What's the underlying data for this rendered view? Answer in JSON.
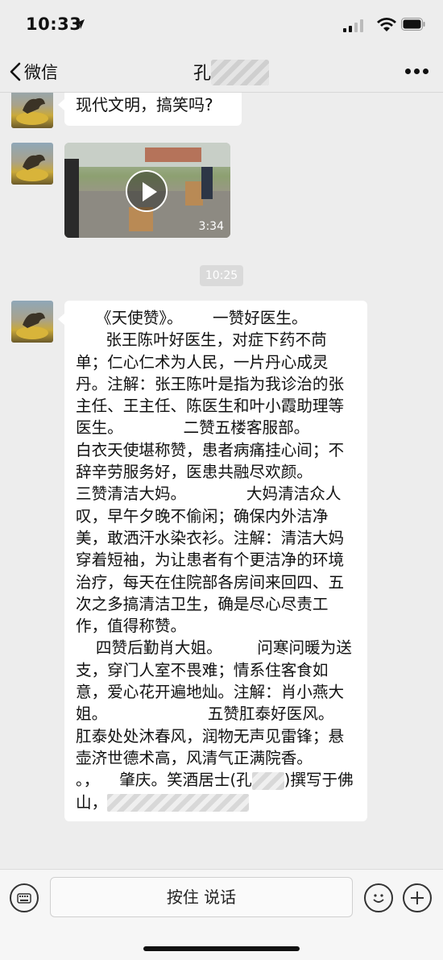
{
  "status_bar": {
    "time": "10:33"
  },
  "nav": {
    "back_label": "微信",
    "title": "孔"
  },
  "messages": {
    "text1": "现代文明，搞笑吗?",
    "video_duration": "3:34",
    "timestamp": "10:25",
    "text2": "    《天使赞》。      一赞好医生。\n      张王陈叶好医生，对症下药不苘单；仁心仁术为人民，一片丹心成灵丹。注解：张王陈叶是指为我诊治的张主任、王主任、陈医生和叶小霞助理等医生。            二赞五楼客服部。        白衣天使堪称赞，患者病痛挂心间；不辞辛劳服务好，医患共融尽欢颜。            三赞清洁大妈。            大妈清洁众人叹，早午夕晚不偷闲；确保内外洁净美，敢洒汗水染衣衫。注解：清洁大妈穿着短袖，为让患者有个更洁净的环境治疗，每天在住院部各房间来回四、五次之多搞清洁卫生，确是尽心尽责工作，值得称赞。\n    四赞后勤肖大姐。       问寒问暖为送支，穿门人室不畏难；情系住客食如意，爱心花开遍地灿。注解：肖小燕大姐。                    五赞肛泰好医风。          肛泰处处沐春风，润物无声见雷锋；悬壶济世德术高，风清气正满院香。          。，    肇庆。笑酒居士(孔",
    "text2_tail": ")撰写于佛山，"
  },
  "input_bar": {
    "talk_label": "按住 说话"
  },
  "icons": [
    "location-arrow-icon",
    "signal-icon",
    "wifi-icon",
    "battery-icon",
    "back-chevron-icon",
    "more-icon",
    "play-icon",
    "keyboard-icon",
    "emoji-icon",
    "plus-icon"
  ]
}
